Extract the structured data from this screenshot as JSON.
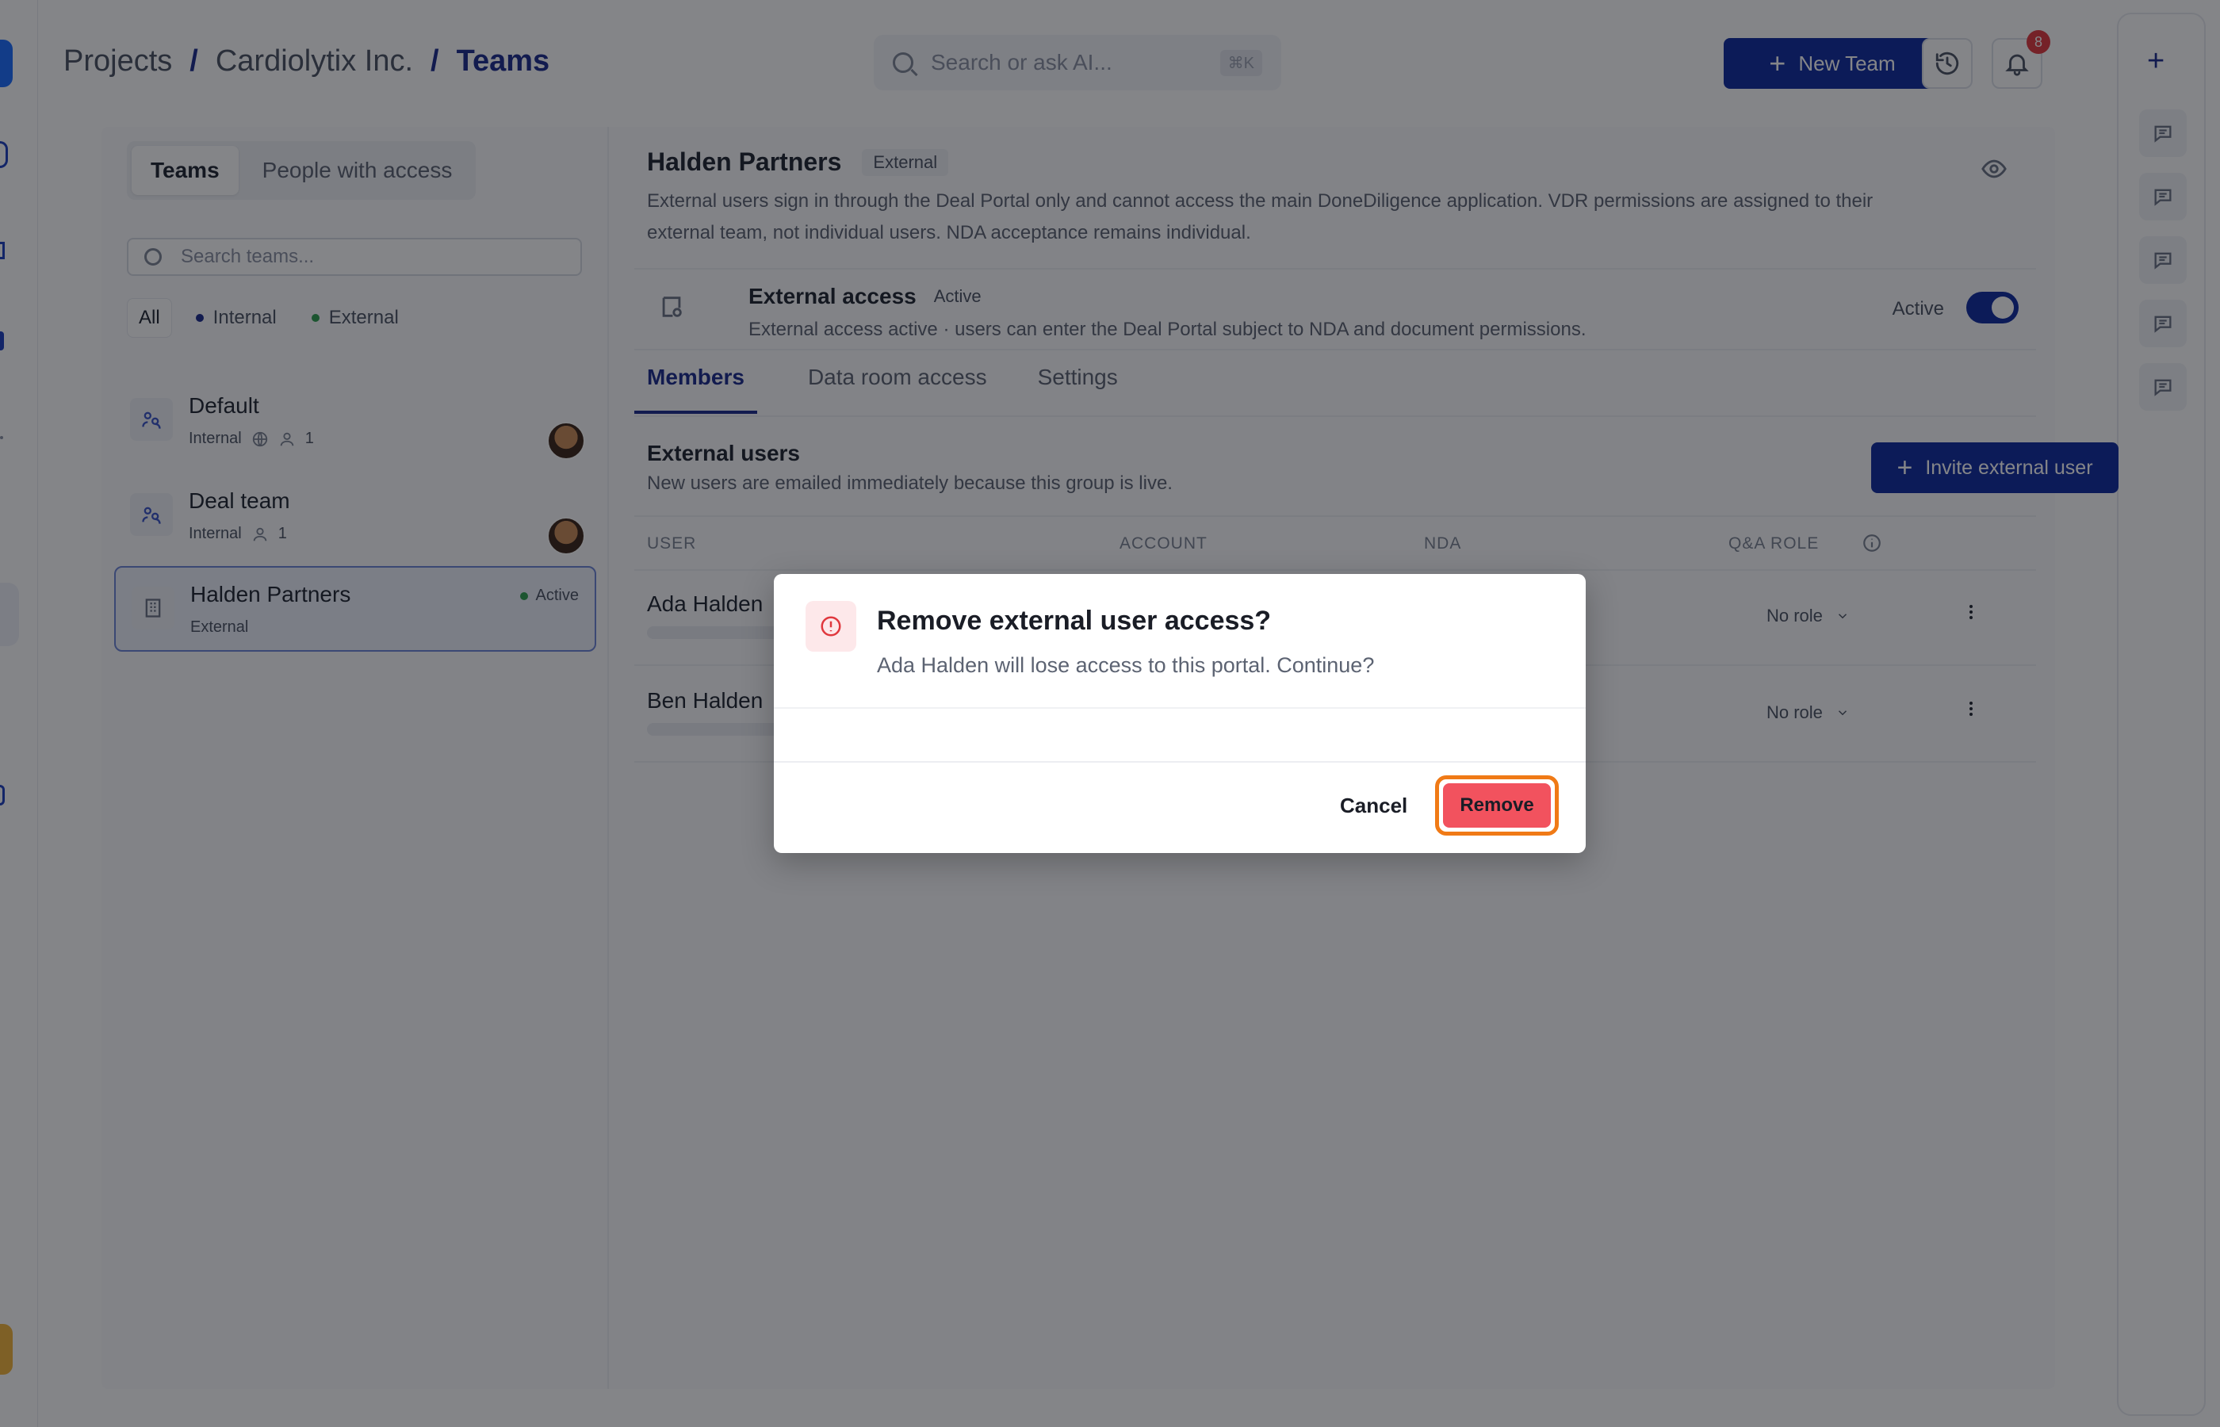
{
  "header": {
    "breadcrumb": [
      "Projects",
      "Cardiolytix Inc.",
      "Teams"
    ],
    "separator": "/",
    "search_placeholder": "Search or ask AI...",
    "search_shortcut": "⌘K",
    "new_team_label": "New Team",
    "notification_count": "8"
  },
  "left_panel": {
    "segments": [
      "Teams",
      "People with access"
    ],
    "team_search_placeholder": "Search teams...",
    "filters": [
      {
        "label": "All",
        "color": ""
      },
      {
        "label": "Internal",
        "color": "#1b2a8c"
      },
      {
        "label": "External",
        "color": "#2e9e4f"
      }
    ],
    "teams": [
      {
        "name": "Default",
        "type": "Internal",
        "members": "1"
      },
      {
        "name": "Deal team",
        "type": "Internal",
        "members": "1"
      },
      {
        "name": "Halden Partners",
        "type": "External",
        "status": "Active"
      }
    ]
  },
  "team_detail": {
    "name": "Halden Partners",
    "tag": "External",
    "description": "External users sign in through the Deal Portal only and cannot access the main DoneDiligence application. VDR permissions are assigned to their external team, not individual users. NDA acceptance remains individual.",
    "external_access": {
      "title": "External access",
      "status": "Active",
      "description": "External access active · users can enter the Deal Portal subject to NDA and document permissions.",
      "toggle_label": "Active"
    },
    "tabs": [
      "Members",
      "Data room access",
      "Settings"
    ],
    "section_title": "External users",
    "section_sub": "New users are emailed immediately because this group is live.",
    "invite_label": "Invite external user",
    "columns": [
      "USER",
      "ACCOUNT",
      "NDA",
      "Q&A ROLE"
    ],
    "users": [
      {
        "name": "Ada Halden",
        "role": "No role"
      },
      {
        "name": "Ben Halden",
        "role": "No role"
      }
    ]
  },
  "modal": {
    "title": "Remove external user access?",
    "body": "Ada Halden will lose access to this portal. Continue?",
    "cancel_label": "Cancel",
    "remove_label": "Remove"
  },
  "colors": {
    "brand": "#0f2a9e",
    "danger": "#f2525e",
    "focus_ring": "#f07a16"
  }
}
